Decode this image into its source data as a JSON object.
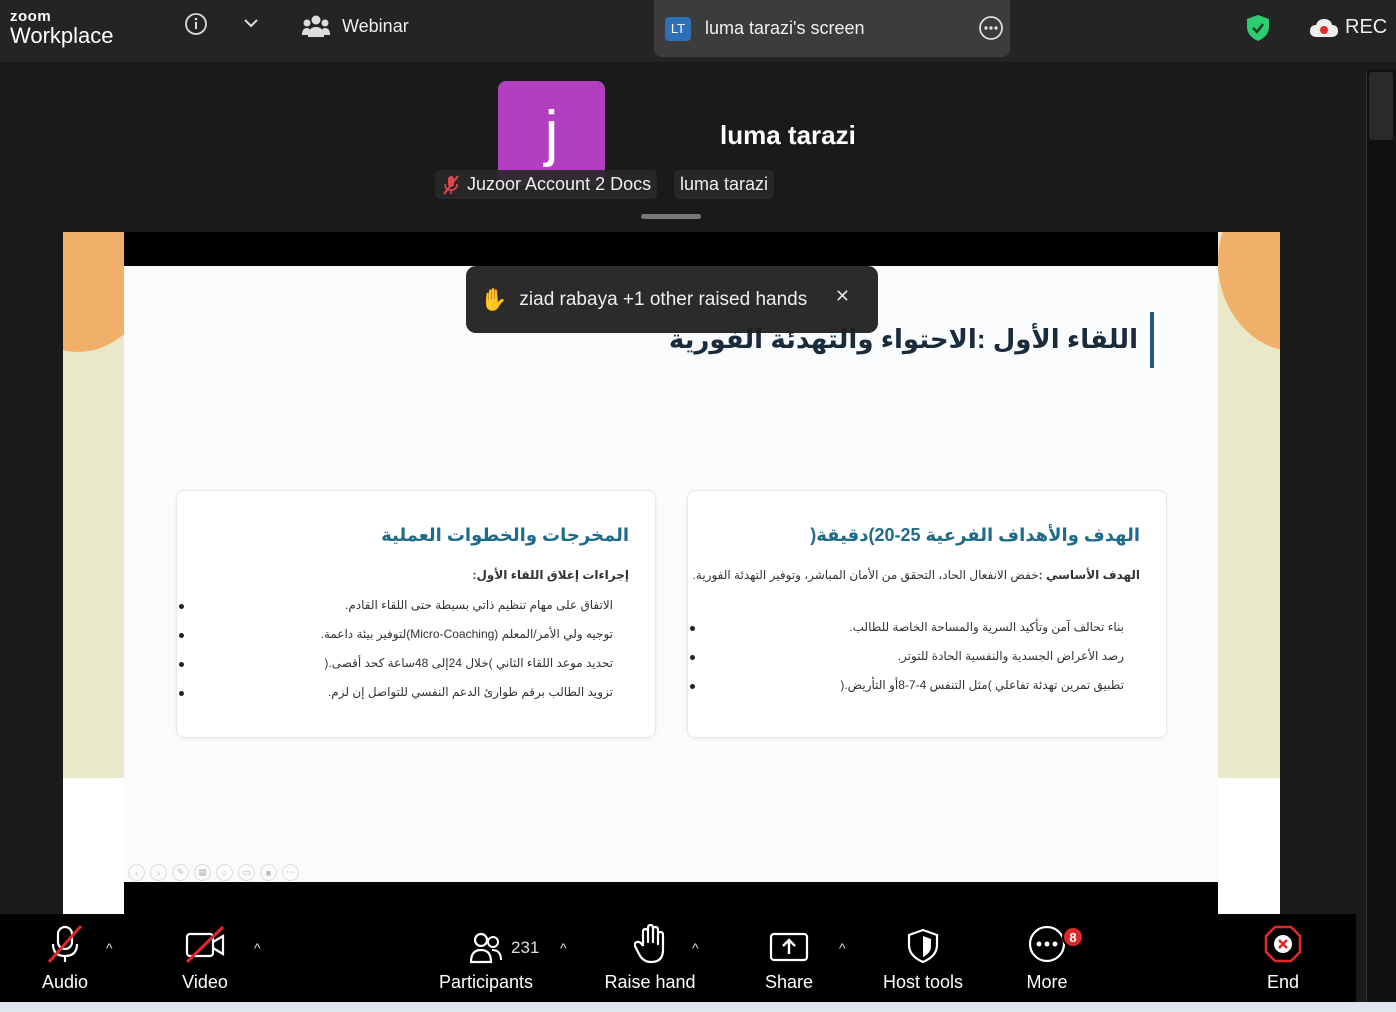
{
  "app": {
    "logo_top": "zoom",
    "logo_bottom": "Workplace",
    "meeting_type": "Webinar",
    "rec_label": "REC"
  },
  "share": {
    "initials": "LT",
    "label": "luma tarazi's screen"
  },
  "participant": {
    "avatar_letter": "j",
    "main_name": "luma tarazi",
    "tag_muted": "Juzoor Account 2 Docs",
    "tag_name": "luma tarazi"
  },
  "notification": {
    "text": "ziad rabaya +1 other raised hands",
    "close": "✕"
  },
  "slide": {
    "title": "اللقاء الأول :الاحتواء والتهدئة الفورية",
    "card_right": {
      "heading": "الهدف والأهداف الفرعية  25-20)دقيقة(",
      "lead_bold": "الهدف الأساسي :",
      "lead_rest": "خفض الانفعال الحاد، التحقق من الأمان المباشر، وتوفير التهدئة الفورية.",
      "items": [
        "بناء تحالف آمن وتأكيد السرية والمساحة الخاصة للطالب.",
        "رصد الأعراض الجسدية والنفسية الحادة للتوتر.",
        "تطبيق تمرين تهدئة تفاعلي )مثل التنفس  4-7-8أو التأريض.("
      ]
    },
    "card_left": {
      "heading": "المخرجات والخطوات العملية",
      "lead_bold": "إجراءات إغلاق اللقاء الأول:",
      "items": [
        "الاتفاق على مهام تنظيم ذاتي بسيطة حتى اللقاء القادم.",
        "توجيه ولي الأمر/المعلم  (Micro-Coaching)لتوفير بيئة داعمة.",
        "تحديد موعد اللقاء الثاني )خلال  24إلى  48ساعة كحد أقصى.(",
        "تزويد الطالب برقم طوارئ الدعم النفسي للتواصل إن لزم."
      ]
    }
  },
  "toolbar": {
    "audio": "Audio",
    "video": "Video",
    "participants": "Participants",
    "participants_count": "231",
    "raise_hand": "Raise hand",
    "share": "Share",
    "host_tools": "Host tools",
    "more": "More",
    "more_badge": "8",
    "end": "End"
  },
  "colors": {
    "topbar": "#242424",
    "avatar": "#b23fc0",
    "slide_heading": "#1f6b8a",
    "accent_orange": "#f0b069",
    "end_red": "#e02828",
    "shield_green": "#2ecc71"
  }
}
